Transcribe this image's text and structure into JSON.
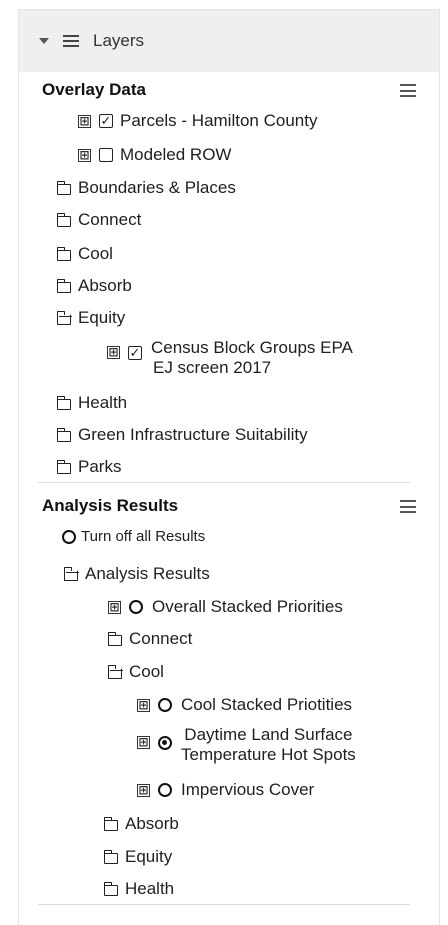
{
  "panel": {
    "title": "Layers"
  },
  "overlay": {
    "title": "Overlay Data",
    "items": [
      {
        "label": "Parcels - Hamilton County"
      },
      {
        "label": "Modeled ROW"
      },
      {
        "label": "Boundaries & Places"
      },
      {
        "label": "Connect"
      },
      {
        "label": "Cool"
      },
      {
        "label": "Absorb"
      },
      {
        "label": "Equity"
      },
      {
        "label": "Census Block Groups EPA",
        "label2": "EJ screen 2017"
      },
      {
        "label": "Health"
      },
      {
        "label": "Green Infrastructure Suitability"
      },
      {
        "label": "Parks"
      }
    ]
  },
  "analysis": {
    "title": "Analysis Results",
    "turn_off": "Turn off all Results",
    "items": [
      {
        "label": "Analysis Results"
      },
      {
        "label": "Overall Stacked Priorities"
      },
      {
        "label": "Connect"
      },
      {
        "label": "Cool"
      },
      {
        "label": "Cool Stacked Priotities"
      },
      {
        "label": "Daytime Land Surface",
        "label2": "Temperature Hot Spots"
      },
      {
        "label": "Impervious Cover"
      },
      {
        "label": "Absorb"
      },
      {
        "label": "Equity"
      },
      {
        "label": "Health"
      }
    ]
  },
  "icons": {
    "expand": "⊞",
    "check": "✓"
  }
}
